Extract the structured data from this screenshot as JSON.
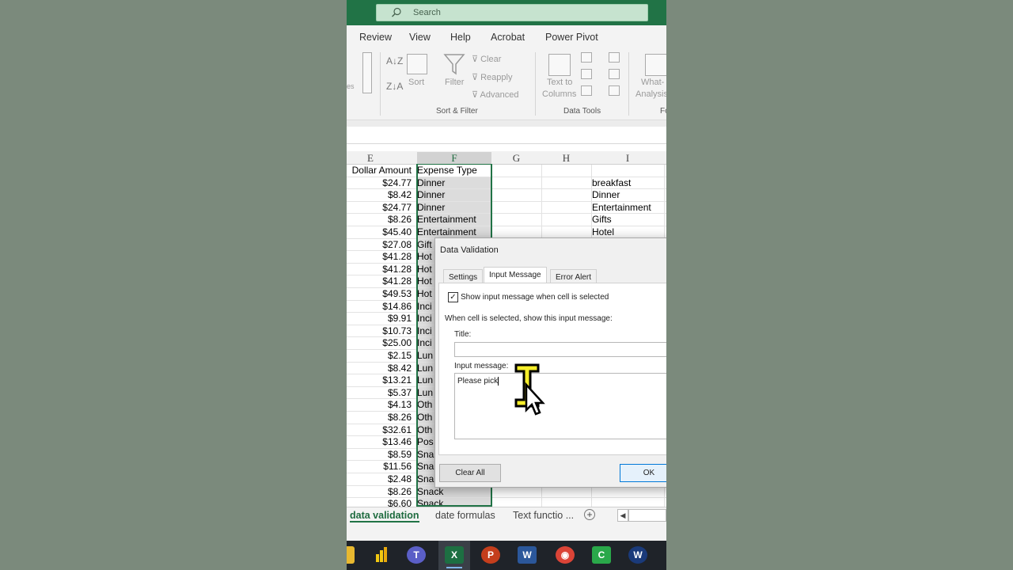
{
  "search": {
    "placeholder": "Search"
  },
  "menu": [
    "Review",
    "View",
    "Help",
    "Acrobat",
    "Power Pivot"
  ],
  "ribbon": {
    "sort_label": "Sort",
    "filter_label": "Filter",
    "clear_label": "Clear",
    "reapply_label": "Reapply",
    "advanced_label": "Advanced",
    "text_to_columns_line1": "Text to",
    "text_to_columns_line2": "Columns",
    "whatif_line1": "What-",
    "whatif_line2": "Analysis",
    "group_sort_filter": "Sort & Filter",
    "group_data_tools": "Data Tools",
    "group_fo": "Fo",
    "partial_left": "es"
  },
  "sheet": {
    "columns": [
      "E",
      "F",
      "G",
      "H",
      "I"
    ],
    "header_row": {
      "e": "Dollar Amount",
      "f": "Expense Type"
    },
    "rows": [
      {
        "e": "$24.77",
        "f": "Dinner",
        "i": "breakfast"
      },
      {
        "e": "$8.42",
        "f": "Dinner",
        "i": "Dinner"
      },
      {
        "e": "$24.77",
        "f": "Dinner",
        "i": "Entertainment"
      },
      {
        "e": "$8.26",
        "f": "Entertainment",
        "i": "Gifts"
      },
      {
        "e": "$45.40",
        "f": "Entertainment",
        "i": "Hotel"
      },
      {
        "e": "$27.08",
        "f": "Gift",
        "i": ""
      },
      {
        "e": "$41.28",
        "f": "Hot",
        "i": ""
      },
      {
        "e": "$41.28",
        "f": "Hot",
        "i": ""
      },
      {
        "e": "$41.28",
        "f": "Hot",
        "i": ""
      },
      {
        "e": "$49.53",
        "f": "Hot",
        "i": ""
      },
      {
        "e": "$14.86",
        "f": "Inci",
        "i": ""
      },
      {
        "e": "$9.91",
        "f": "Inci",
        "i": ""
      },
      {
        "e": "$10.73",
        "f": "Inci",
        "i": ""
      },
      {
        "e": "$25.00",
        "f": "Inci",
        "i": ""
      },
      {
        "e": "$2.15",
        "f": "Lun",
        "i": ""
      },
      {
        "e": "$8.42",
        "f": "Lun",
        "i": ""
      },
      {
        "e": "$13.21",
        "f": "Lun",
        "i": ""
      },
      {
        "e": "$5.37",
        "f": "Lun",
        "i": ""
      },
      {
        "e": "$4.13",
        "f": "Oth",
        "i": ""
      },
      {
        "e": "$8.26",
        "f": "Oth",
        "i": ""
      },
      {
        "e": "$32.61",
        "f": "Oth",
        "i": ""
      },
      {
        "e": "$13.46",
        "f": "Pos",
        "i": ""
      },
      {
        "e": "$8.59",
        "f": "Sna",
        "i": ""
      },
      {
        "e": "$11.56",
        "f": "Sna",
        "i": ""
      },
      {
        "e": "$2.48",
        "f": "Sna",
        "i": ""
      },
      {
        "e": "$8.26",
        "f": "Snack",
        "i": ""
      },
      {
        "e": "$6.60",
        "f": "Snack",
        "i": ""
      }
    ]
  },
  "sheet_tabs": [
    "data validation",
    "date formulas",
    "Text functio ..."
  ],
  "dialog": {
    "title": "Data Validation",
    "tabs": [
      "Settings",
      "Input Message",
      "Error Alert"
    ],
    "checkbox_label": "Show input message when cell is selected",
    "checkbox_checked": true,
    "section_label": "When cell is selected, show this input message:",
    "title_label": "Title:",
    "title_value": "",
    "message_label": "Input message:",
    "message_value": "Please pick",
    "clear_all_label": "Clear All",
    "ok_label": "OK"
  },
  "colors": {
    "excel_green": "#217346",
    "taskbar": "#1f2329",
    "background": "#7b8a7c"
  }
}
